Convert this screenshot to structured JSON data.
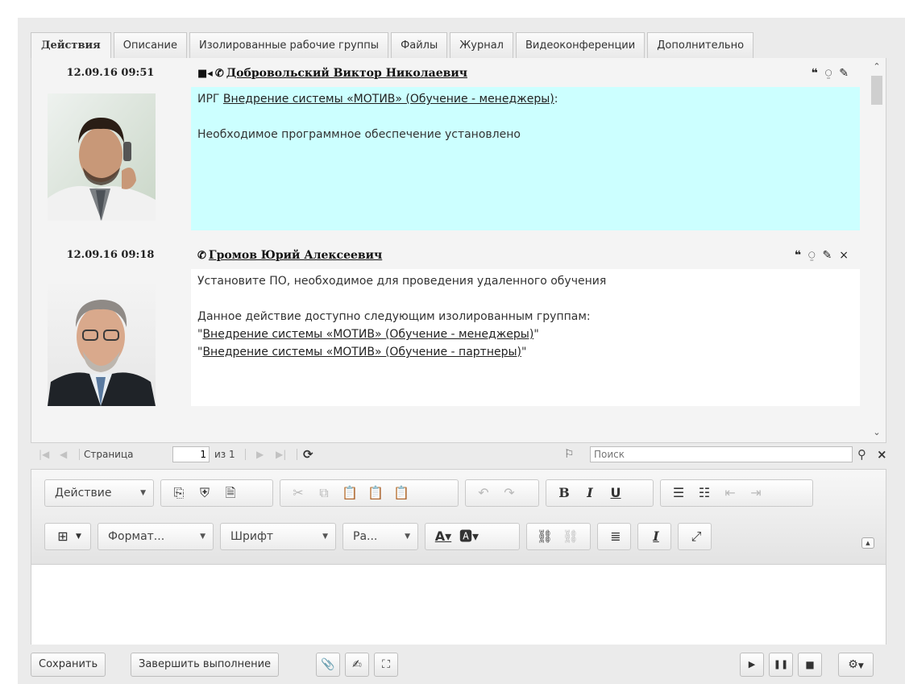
{
  "tabs": [
    {
      "label": "Действия",
      "active": true
    },
    {
      "label": "Описание"
    },
    {
      "label": "Изолированные рабочие группы"
    },
    {
      "label": "Файлы"
    },
    {
      "label": "Журнал"
    },
    {
      "label": "Видеоконференции"
    },
    {
      "label": "Дополнительно"
    }
  ],
  "entries": [
    {
      "date": "12.09.16 09:51",
      "icons": [
        "video-camera-icon",
        "phone-icon"
      ],
      "author": "Добровольский Виктор Николаевич",
      "actions": [
        "quote-icon",
        "visibility-icon",
        "edit-icon"
      ],
      "prefix": "ИРГ ",
      "link": "Внедрение системы «МОТИВ» (Обучение - менеджеры)",
      "suffix": ":",
      "body": "Необходимое программное обеспечение установлено",
      "highlight": "#ccffff"
    },
    {
      "date": "12.09.16 09:18",
      "icons": [
        "phone-icon"
      ],
      "author": "Громов Юрий Алексеевич",
      "actions": [
        "quote-icon",
        "visibility-icon",
        "edit-icon",
        "delete-icon"
      ],
      "line1": "Установите ПО, необходимое для проведения удаленного обучения",
      "line2": "Данное действие доступно следующим изолированным группам:",
      "group1": "Внедрение системы «МОТИВ» (Обучение - менеджеры)",
      "group2": "Внедрение системы «МОТИВ» (Обучение - партнеры)",
      "quote": "\""
    }
  ],
  "pager": {
    "page_label": "Страница",
    "page_value": "1",
    "of_label": "из 1",
    "search_placeholder": "Поиск"
  },
  "editor": {
    "action_label": "Действие",
    "format_label": "Формат...",
    "font_label": "Шрифт",
    "size_label": "Ра..."
  },
  "bottom": {
    "save_label": "Сохранить",
    "complete_label": "Завершить выполнение"
  },
  "colors": {
    "highlight": "#ccffff",
    "frame": "#ebebeb"
  }
}
